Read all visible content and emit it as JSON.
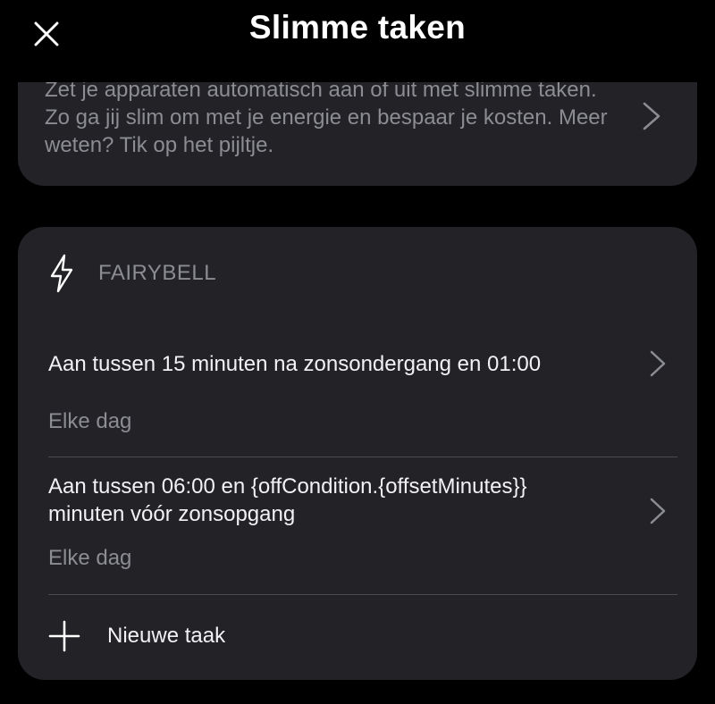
{
  "header": {
    "title": "Slimme taken",
    "close_icon": "close-icon"
  },
  "info": {
    "text": "Zet je apparaten automatisch aan of uit met slimme taken. Zo ga jij slim om met je energie en bespaar je kosten. Meer weten? Tik op het pijltje.",
    "chevron_icon": "chevron-right-icon"
  },
  "device": {
    "icon": "lightning-icon",
    "name": "FAIRYBELL",
    "tasks": [
      {
        "title": "Aan tussen 15 minuten na zonsondergang en 01:00",
        "schedule": "Elke dag"
      },
      {
        "title": "Aan tussen 06:00 en {offCondition.{offsetMinutes}} minuten vóór zonsopgang",
        "schedule": "Elke dag"
      }
    ],
    "new_task_label": "Nieuwe taak"
  },
  "colors": {
    "background": "#000000",
    "card": "#222227",
    "muted_text": "#8b8d93",
    "primary_text": "#f2f2f4",
    "divider": "#4a4b50"
  }
}
